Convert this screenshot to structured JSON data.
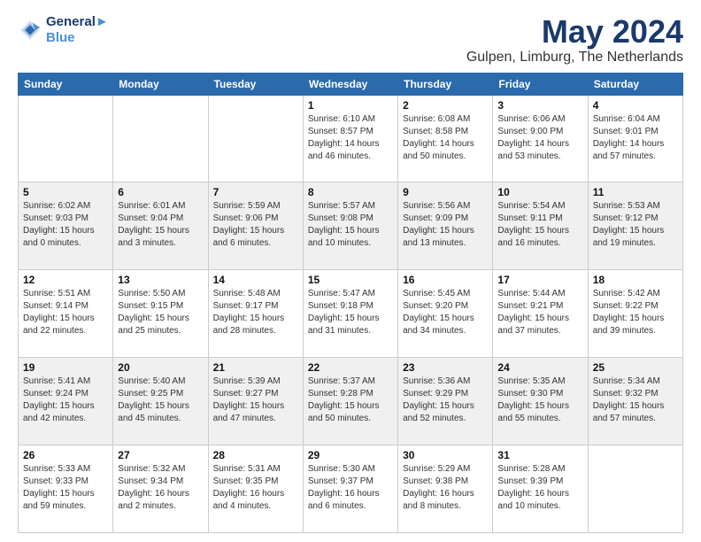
{
  "header": {
    "logo_line1": "General",
    "logo_line2": "Blue",
    "month": "May 2024",
    "location": "Gulpen, Limburg, The Netherlands"
  },
  "days_of_week": [
    "Sunday",
    "Monday",
    "Tuesday",
    "Wednesday",
    "Thursday",
    "Friday",
    "Saturday"
  ],
  "weeks": [
    [
      {
        "day": "",
        "content": ""
      },
      {
        "day": "",
        "content": ""
      },
      {
        "day": "",
        "content": ""
      },
      {
        "day": "1",
        "content": "Sunrise: 6:10 AM\nSunset: 8:57 PM\nDaylight: 14 hours\nand 46 minutes."
      },
      {
        "day": "2",
        "content": "Sunrise: 6:08 AM\nSunset: 8:58 PM\nDaylight: 14 hours\nand 50 minutes."
      },
      {
        "day": "3",
        "content": "Sunrise: 6:06 AM\nSunset: 9:00 PM\nDaylight: 14 hours\nand 53 minutes."
      },
      {
        "day": "4",
        "content": "Sunrise: 6:04 AM\nSunset: 9:01 PM\nDaylight: 14 hours\nand 57 minutes."
      }
    ],
    [
      {
        "day": "5",
        "content": "Sunrise: 6:02 AM\nSunset: 9:03 PM\nDaylight: 15 hours\nand 0 minutes."
      },
      {
        "day": "6",
        "content": "Sunrise: 6:01 AM\nSunset: 9:04 PM\nDaylight: 15 hours\nand 3 minutes."
      },
      {
        "day": "7",
        "content": "Sunrise: 5:59 AM\nSunset: 9:06 PM\nDaylight: 15 hours\nand 6 minutes."
      },
      {
        "day": "8",
        "content": "Sunrise: 5:57 AM\nSunset: 9:08 PM\nDaylight: 15 hours\nand 10 minutes."
      },
      {
        "day": "9",
        "content": "Sunrise: 5:56 AM\nSunset: 9:09 PM\nDaylight: 15 hours\nand 13 minutes."
      },
      {
        "day": "10",
        "content": "Sunrise: 5:54 AM\nSunset: 9:11 PM\nDaylight: 15 hours\nand 16 minutes."
      },
      {
        "day": "11",
        "content": "Sunrise: 5:53 AM\nSunset: 9:12 PM\nDaylight: 15 hours\nand 19 minutes."
      }
    ],
    [
      {
        "day": "12",
        "content": "Sunrise: 5:51 AM\nSunset: 9:14 PM\nDaylight: 15 hours\nand 22 minutes."
      },
      {
        "day": "13",
        "content": "Sunrise: 5:50 AM\nSunset: 9:15 PM\nDaylight: 15 hours\nand 25 minutes."
      },
      {
        "day": "14",
        "content": "Sunrise: 5:48 AM\nSunset: 9:17 PM\nDaylight: 15 hours\nand 28 minutes."
      },
      {
        "day": "15",
        "content": "Sunrise: 5:47 AM\nSunset: 9:18 PM\nDaylight: 15 hours\nand 31 minutes."
      },
      {
        "day": "16",
        "content": "Sunrise: 5:45 AM\nSunset: 9:20 PM\nDaylight: 15 hours\nand 34 minutes."
      },
      {
        "day": "17",
        "content": "Sunrise: 5:44 AM\nSunset: 9:21 PM\nDaylight: 15 hours\nand 37 minutes."
      },
      {
        "day": "18",
        "content": "Sunrise: 5:42 AM\nSunset: 9:22 PM\nDaylight: 15 hours\nand 39 minutes."
      }
    ],
    [
      {
        "day": "19",
        "content": "Sunrise: 5:41 AM\nSunset: 9:24 PM\nDaylight: 15 hours\nand 42 minutes."
      },
      {
        "day": "20",
        "content": "Sunrise: 5:40 AM\nSunset: 9:25 PM\nDaylight: 15 hours\nand 45 minutes."
      },
      {
        "day": "21",
        "content": "Sunrise: 5:39 AM\nSunset: 9:27 PM\nDaylight: 15 hours\nand 47 minutes."
      },
      {
        "day": "22",
        "content": "Sunrise: 5:37 AM\nSunset: 9:28 PM\nDaylight: 15 hours\nand 50 minutes."
      },
      {
        "day": "23",
        "content": "Sunrise: 5:36 AM\nSunset: 9:29 PM\nDaylight: 15 hours\nand 52 minutes."
      },
      {
        "day": "24",
        "content": "Sunrise: 5:35 AM\nSunset: 9:30 PM\nDaylight: 15 hours\nand 55 minutes."
      },
      {
        "day": "25",
        "content": "Sunrise: 5:34 AM\nSunset: 9:32 PM\nDaylight: 15 hours\nand 57 minutes."
      }
    ],
    [
      {
        "day": "26",
        "content": "Sunrise: 5:33 AM\nSunset: 9:33 PM\nDaylight: 15 hours\nand 59 minutes."
      },
      {
        "day": "27",
        "content": "Sunrise: 5:32 AM\nSunset: 9:34 PM\nDaylight: 16 hours\nand 2 minutes."
      },
      {
        "day": "28",
        "content": "Sunrise: 5:31 AM\nSunset: 9:35 PM\nDaylight: 16 hours\nand 4 minutes."
      },
      {
        "day": "29",
        "content": "Sunrise: 5:30 AM\nSunset: 9:37 PM\nDaylight: 16 hours\nand 6 minutes."
      },
      {
        "day": "30",
        "content": "Sunrise: 5:29 AM\nSunset: 9:38 PM\nDaylight: 16 hours\nand 8 minutes."
      },
      {
        "day": "31",
        "content": "Sunrise: 5:28 AM\nSunset: 9:39 PM\nDaylight: 16 hours\nand 10 minutes."
      },
      {
        "day": "",
        "content": ""
      }
    ]
  ]
}
